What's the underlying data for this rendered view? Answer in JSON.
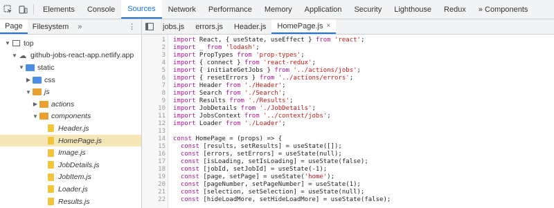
{
  "devtools": {
    "tabs": [
      {
        "label": "Elements"
      },
      {
        "label": "Console"
      },
      {
        "label": "Sources"
      },
      {
        "label": "Network"
      },
      {
        "label": "Performance"
      },
      {
        "label": "Memory"
      },
      {
        "label": "Application"
      },
      {
        "label": "Security"
      },
      {
        "label": "Lighthouse"
      },
      {
        "label": "Redux"
      },
      {
        "label": "» Components"
      }
    ],
    "active_tab": "Sources"
  },
  "navigator": {
    "tabs": [
      {
        "label": "Page"
      },
      {
        "label": "Filesystem"
      }
    ],
    "more_label": "»",
    "menu_label": "⋮",
    "tree": [
      {
        "label": "top",
        "depth": 0,
        "icon": "frame-icon",
        "expanded": true
      },
      {
        "label": "github-jobs-react-app.netlify.app",
        "depth": 1,
        "icon": "cloud-icon",
        "expanded": true
      },
      {
        "label": "static",
        "depth": 2,
        "icon": "folder-icon",
        "color": "blue",
        "expanded": true
      },
      {
        "label": "css",
        "depth": 3,
        "icon": "folder-icon",
        "color": "blue",
        "expanded": false
      },
      {
        "label": "js",
        "depth": 3,
        "icon": "folder-icon",
        "color": "orange",
        "expanded": true,
        "italic": true
      },
      {
        "label": "actions",
        "depth": 4,
        "icon": "folder-icon",
        "color": "orange",
        "expanded": false,
        "italic": true
      },
      {
        "label": "components",
        "depth": 4,
        "icon": "folder-icon",
        "color": "orange",
        "expanded": true,
        "italic": true
      },
      {
        "label": "Header.js",
        "depth": 5,
        "icon": "file-icon",
        "italic": true
      },
      {
        "label": "HomePage.js",
        "depth": 5,
        "icon": "file-icon",
        "italic": true,
        "selected": true
      },
      {
        "label": "Image.js",
        "depth": 5,
        "icon": "file-icon",
        "italic": true
      },
      {
        "label": "JobDetails.js",
        "depth": 5,
        "icon": "file-icon",
        "italic": true
      },
      {
        "label": "JobItem.js",
        "depth": 5,
        "icon": "file-icon",
        "italic": true
      },
      {
        "label": "Loader.js",
        "depth": 5,
        "icon": "file-icon",
        "italic": true
      },
      {
        "label": "Results.js",
        "depth": 5,
        "icon": "file-icon",
        "italic": true
      }
    ]
  },
  "editor": {
    "tabs": [
      {
        "label": "jobs.js"
      },
      {
        "label": "errors.js"
      },
      {
        "label": "Header.js"
      },
      {
        "label": "HomePage.js",
        "active": true
      }
    ],
    "close_label": "×",
    "lines": [
      {
        "n": "1",
        "code": "import React, { useState, useEffect } from 'react';"
      },
      {
        "n": "2",
        "code": "import _ from 'lodash';"
      },
      {
        "n": "3",
        "code": "import PropTypes from 'prop-types';"
      },
      {
        "n": "4",
        "code": "import { connect } from 'react-redux';"
      },
      {
        "n": "5",
        "code": "import { initiateGetJobs } from '../actions/jobs';"
      },
      {
        "n": "6",
        "code": "import { resetErrors } from '../actions/errors';"
      },
      {
        "n": "7",
        "code": "import Header from './Header';"
      },
      {
        "n": "8",
        "code": "import Search from './Search';"
      },
      {
        "n": "9",
        "code": "import Results from './Results';"
      },
      {
        "n": "10",
        "code": "import JobDetails from './JobDetails';"
      },
      {
        "n": "11",
        "code": "import JobsContext from '../context/jobs';"
      },
      {
        "n": "12",
        "code": "import Loader from './Loader';"
      },
      {
        "n": "13",
        "code": ""
      },
      {
        "n": "14",
        "code": "const HomePage = (props) => {"
      },
      {
        "n": "15",
        "code": "  const [results, setResults] = useState([]);"
      },
      {
        "n": "16",
        "code": "  const [errors, setErrors] = useState(null);"
      },
      {
        "n": "17",
        "code": "  const [isLoading, setIsLoading] = useState(false);"
      },
      {
        "n": "18",
        "code": "  const [jobId, setJobId] = useState(-1);"
      },
      {
        "n": "19",
        "code": "  const [page, setPage] = useState('home');"
      },
      {
        "n": "20",
        "code": "  const [pageNumber, setPageNumber] = useState(1);"
      },
      {
        "n": "21",
        "code": "  const [selection, setSelection] = useState(null);"
      },
      {
        "n": "22",
        "code": "  const [hideLoadMore, setHideLoadMore] = useState(false);"
      }
    ]
  }
}
